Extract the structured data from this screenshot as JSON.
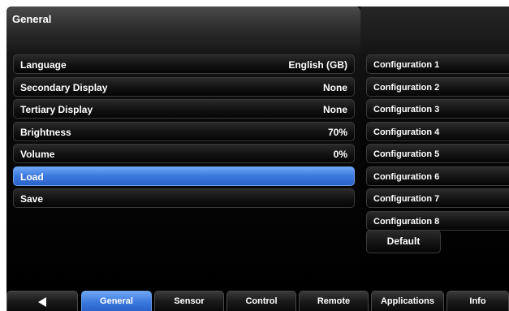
{
  "panel": {
    "title": "General"
  },
  "settings": [
    {
      "label": "Language",
      "value": "English (GB)",
      "active": false
    },
    {
      "label": "Secondary Display",
      "value": "None",
      "active": false
    },
    {
      "label": "Tertiary Display",
      "value": "None",
      "active": false
    },
    {
      "label": "Brightness",
      "value": "70%",
      "active": false
    },
    {
      "label": "Volume",
      "value": "0%",
      "active": false
    },
    {
      "label": "Load",
      "value": "",
      "active": true
    },
    {
      "label": "Save",
      "value": "",
      "active": false
    }
  ],
  "configurations": [
    "Configuration 1",
    "Configuration 2",
    "Configuration 3",
    "Configuration 4",
    "Configuration 5",
    "Configuration 6",
    "Configuration 7",
    "Configuration 8"
  ],
  "default_label": "Default",
  "tabs": {
    "back_icon": "left-triangle-icon",
    "items": [
      {
        "label": "General",
        "active": true
      },
      {
        "label": "Sensor",
        "active": false
      },
      {
        "label": "Control",
        "active": false
      },
      {
        "label": "Remote",
        "active": false
      },
      {
        "label": "Applications",
        "active": false
      },
      {
        "label": "Info",
        "active": false
      }
    ]
  },
  "colors": {
    "accent": "#3b78dd",
    "background": "#000000",
    "text": "#ffffff"
  }
}
